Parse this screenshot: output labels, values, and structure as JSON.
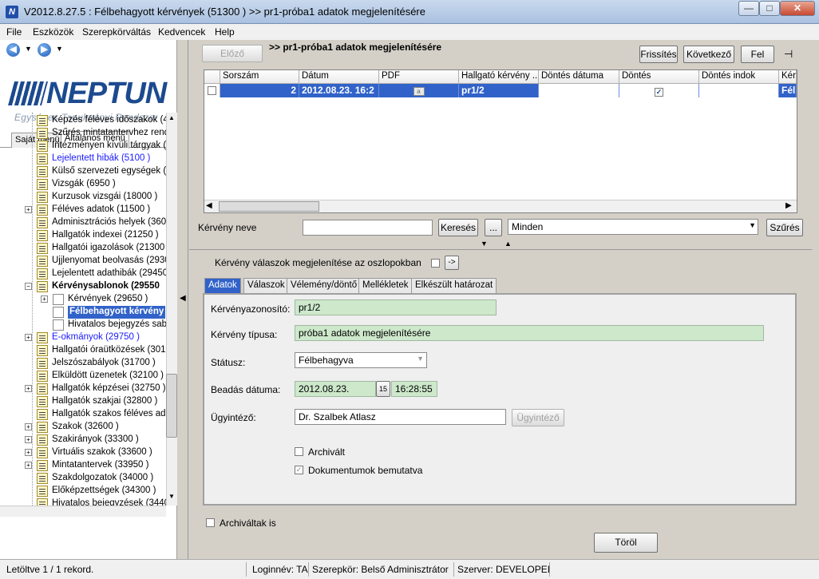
{
  "window": {
    "title": "V2012.8.27.5 : Félbehagyott kérvények (51300 )  >> pr1-próba1 adatok megjelenítésére",
    "app_icon": "N",
    "min_glyph": "—",
    "max_glyph": "□",
    "close_glyph": "✕"
  },
  "menu": [
    "File",
    "Eszközök",
    "Szerepkörváltás",
    "Kedvencek",
    "Help"
  ],
  "logo": {
    "name": "NEPTUN",
    "subtitle": "Egységes Tanulmányi Rendszer"
  },
  "left_tabs": [
    "Saját menü",
    "Általános menü"
  ],
  "tree": [
    {
      "label": "Képzés féléves időszakok (44",
      "style": "normal",
      "indent": 0,
      "expander": ""
    },
    {
      "label": "Szűrés mintatantervhez rende",
      "style": "normal",
      "indent": 0,
      "expander": ""
    },
    {
      "label": "Intézményen kívüli tárgyak (4",
      "style": "normal",
      "indent": 0,
      "expander": ""
    },
    {
      "label": "Lejelentett hibák (5100 )",
      "style": "blue",
      "indent": 0,
      "expander": ""
    },
    {
      "label": "Külső szervezeti egységek (68",
      "style": "normal",
      "indent": 0,
      "expander": ""
    },
    {
      "label": "Vizsgák (6950 )",
      "style": "normal",
      "indent": 0,
      "expander": ""
    },
    {
      "label": "Kurzusok vizsgái (18000 )",
      "style": "normal",
      "indent": 0,
      "expander": ""
    },
    {
      "label": "Féléves adatok (11500 )",
      "style": "normal",
      "indent": 0,
      "expander": "+"
    },
    {
      "label": "Adminisztrációs helyek (3600",
      "style": "normal",
      "indent": 0,
      "expander": ""
    },
    {
      "label": "Hallgatók indexei (21250 )",
      "style": "normal",
      "indent": 0,
      "expander": ""
    },
    {
      "label": "Hallgatói igazolások (21300 )",
      "style": "normal",
      "indent": 0,
      "expander": ""
    },
    {
      "label": "Ujjlenyomat beolvasás (29300",
      "style": "normal",
      "indent": 0,
      "expander": ""
    },
    {
      "label": "Lejelentett adathibák (29450",
      "style": "normal",
      "indent": 0,
      "expander": ""
    },
    {
      "label": "Kérvénysablonok (29550",
      "style": "bold",
      "indent": 0,
      "expander": "−"
    },
    {
      "label": "Kérvények (29650 )",
      "style": "normal",
      "indent": 1,
      "expander": "+"
    },
    {
      "label": "Félbehagyott kérvény",
      "style": "selected",
      "indent": 1,
      "expander": ""
    },
    {
      "label": "Hivatalos bejegyzés sablo",
      "style": "normal",
      "indent": 1,
      "expander": ""
    },
    {
      "label": "E-okmányok (29750 )",
      "style": "blue",
      "indent": 0,
      "expander": "+"
    },
    {
      "label": "Hallgatói óraütközések (30100",
      "style": "normal",
      "indent": 0,
      "expander": ""
    },
    {
      "label": "Jelszószabályok (31700 )",
      "style": "normal",
      "indent": 0,
      "expander": ""
    },
    {
      "label": "Elküldött üzenetek (32100 )",
      "style": "normal",
      "indent": 0,
      "expander": ""
    },
    {
      "label": "Hallgatók képzései (32750 )",
      "style": "normal",
      "indent": 0,
      "expander": "+"
    },
    {
      "label": "Hallgatók szakjai (32800 )",
      "style": "normal",
      "indent": 0,
      "expander": ""
    },
    {
      "label": "Hallgatók szakos féléves ada",
      "style": "normal",
      "indent": 0,
      "expander": ""
    },
    {
      "label": "Szakok (32600 )",
      "style": "normal",
      "indent": 0,
      "expander": "+"
    },
    {
      "label": "Szakirányok (33300 )",
      "style": "normal",
      "indent": 0,
      "expander": "+"
    },
    {
      "label": "Virtuális szakok (33600 )",
      "style": "normal",
      "indent": 0,
      "expander": "+"
    },
    {
      "label": "Mintatantervek (33950 )",
      "style": "normal",
      "indent": 0,
      "expander": "+"
    },
    {
      "label": "Szakdolgozatok (34000 )",
      "style": "normal",
      "indent": 0,
      "expander": ""
    },
    {
      "label": "Előképzettségek (34300 )",
      "style": "normal",
      "indent": 0,
      "expander": ""
    },
    {
      "label": "Hivatalos bejegyzések (34400",
      "style": "normal",
      "indent": 0,
      "expander": ""
    }
  ],
  "toolbar": {
    "prev_label": "Előző",
    "title": ">> pr1-próba1 adatok megjelenítésére",
    "refresh_label": "Frissítés",
    "next_label": "Következő",
    "up_label": "Fel",
    "pin_glyph": "⊣"
  },
  "grid": {
    "columns": [
      "Sorszám",
      "Dátum",
      "PDF",
      "Hallgató kérvény ...",
      "Döntés dátuma",
      "Döntés",
      "Döntés indok",
      "Kérv"
    ],
    "row": {
      "sorszam": "2",
      "datum": "2012.08.23. 16:2",
      "pdf": "a",
      "hallgato": "pr1/2",
      "dontes_datuma": "",
      "dontes": "✓",
      "dontes_indok": "",
      "kerv": "Félb"
    }
  },
  "search": {
    "label": "Kérvény neve",
    "value": "",
    "search_label": "Keresés",
    "dots_label": "...",
    "filter_value": "Minden",
    "filter_button": "Szűrés"
  },
  "columns_option": {
    "label": "Kérvény válaszok megjelenítése az oszlopokban",
    "checked": false,
    "go_label": "->"
  },
  "tabs": [
    "Adatok",
    "Válaszok",
    "Vélemény/döntő",
    "Mellékletek",
    "Elkészült határozat"
  ],
  "form": {
    "id_label": "Kérvényazonosító:",
    "id_value": "pr1/2",
    "type_label": "Kérvény típusa:",
    "type_value": "próba1 adatok megjelenítésére",
    "status_label": "Státusz:",
    "status_value": "Félbehagyva",
    "date_label": "Beadás dátuma:",
    "date_value": "2012.08.23.",
    "cal_glyph": "15",
    "time_value": "16:28:55",
    "agent_label": "Ügyintéző:",
    "agent_value": "Dr. Szalbek Atlasz",
    "agent_button": "Ügyintéző",
    "archived_label": "Archivált",
    "archived_checked": false,
    "docs_label": "Dokumentumok bemutatva",
    "docs_checked": true
  },
  "bottom": {
    "archived_too_label": "Archiváltak is",
    "delete_label": "Töröl"
  },
  "status": {
    "records": "Letöltve 1 / 1 rekord.",
    "login": "Loginnév: TA",
    "role": "Szerepkör: Belső Adminisztrátor",
    "server": "Szerver: DEVELOPEI"
  }
}
